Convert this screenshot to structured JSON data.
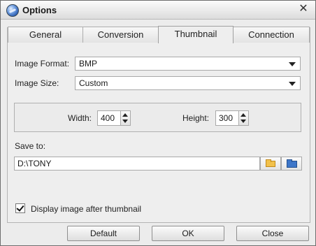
{
  "window": {
    "title": "Options"
  },
  "tabs": [
    {
      "label": "General"
    },
    {
      "label": "Conversion"
    },
    {
      "label": "Thumbnail"
    },
    {
      "label": "Connection"
    }
  ],
  "active_tab": "Thumbnail",
  "thumbnail": {
    "image_format": {
      "label": "Image Format:",
      "value": "BMP"
    },
    "image_size": {
      "label": "Image Size:",
      "value": "Custom"
    },
    "width": {
      "label": "Width:",
      "value": "400"
    },
    "height": {
      "label": "Height:",
      "value": "300"
    },
    "save_to": {
      "label": "Save to:",
      "value": "D:\\TONY"
    },
    "display_after": {
      "label": "Display image after thumbnail",
      "checked": true
    }
  },
  "buttons": {
    "default": "Default",
    "ok": "OK",
    "close": "Close"
  },
  "icons": {
    "app": "app-globe-icon",
    "close": "close-icon",
    "browse": "folder-open-icon",
    "open_folder": "folder-icon"
  }
}
